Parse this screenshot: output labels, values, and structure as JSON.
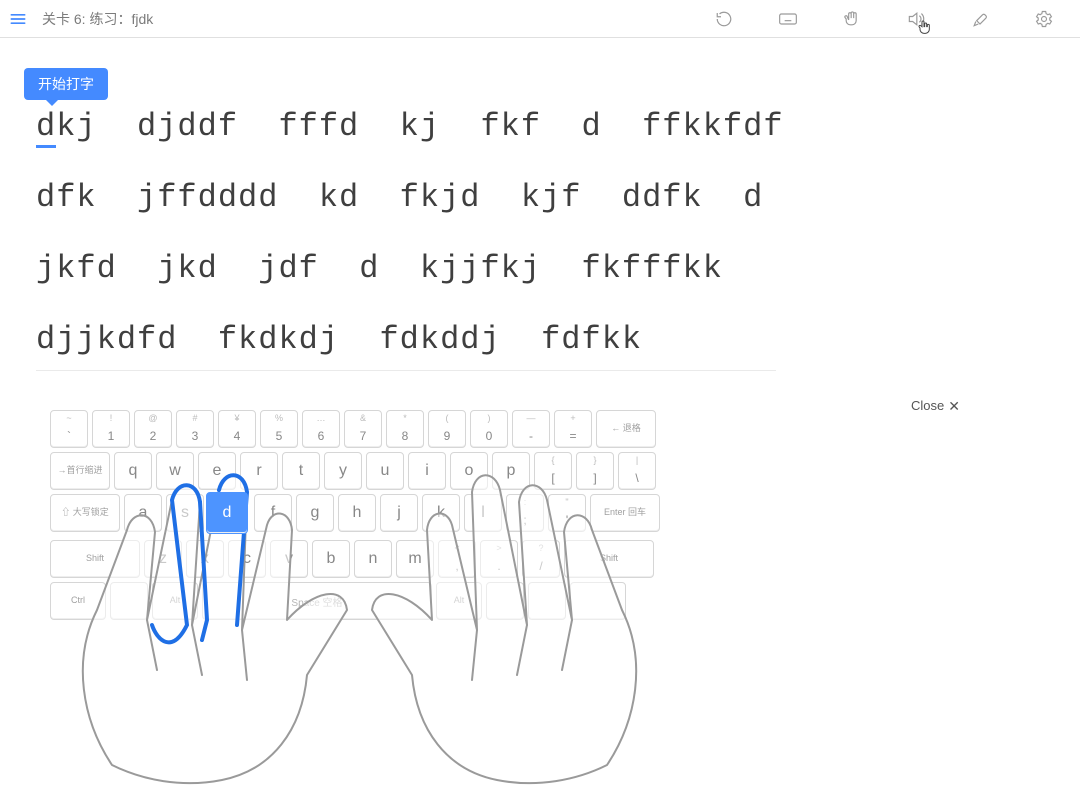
{
  "header": {
    "level_prefix": "关卡 6: 练习：",
    "level_name": "fjdk"
  },
  "tooltip": {
    "start_typing": "开始打字"
  },
  "text_lines": [
    "dkj  djddf  fffd  kj  fkf  d  ffkkfdf",
    "dfk  jffdddd  kd  fkjd  kjf  ddfk  d",
    "jkfd  jkd  jdf  d  kjjfkj  fkfffkk",
    "djjkdfd  fkdkdj  fdkddj  fdfkk"
  ],
  "close": {
    "label": "Close"
  },
  "keys": {
    "backspace": "← 退格",
    "tab": "→首行缩进",
    "caps": "⇧ 大写锁定",
    "enter": "Enter 回车",
    "shift": "Shift",
    "ctrl": "Ctrl",
    "alt": "Alt",
    "space": "Space 空格",
    "row1_tops": [
      "~",
      "!",
      "@",
      "#",
      "¥",
      "%",
      "…",
      "&",
      "*",
      "(",
      ")",
      "—",
      "+"
    ],
    "row1_mains": [
      "`",
      "1",
      "2",
      "3",
      "4",
      "5",
      "6",
      "7",
      "8",
      "9",
      "0",
      "-",
      "="
    ],
    "row2": [
      "q",
      "w",
      "e",
      "r",
      "t",
      "y",
      "u",
      "i",
      "o",
      "p"
    ],
    "row2_bracket_tops": [
      "{",
      "}",
      "|"
    ],
    "row2_bracket_mains": [
      "[",
      "]",
      "\\"
    ],
    "row3": [
      "a",
      "s",
      "d",
      "f",
      "g",
      "h",
      "j",
      "k",
      "l"
    ],
    "row3_tops": [
      ":",
      "\""
    ],
    "row3_mains": [
      ";",
      "'"
    ],
    "row4": [
      "z",
      "x",
      "c",
      "v",
      "b",
      "n",
      "m"
    ],
    "row4_tops": [
      "<",
      ">",
      "?"
    ],
    "row4_mains": [
      ",",
      ".",
      "/"
    ],
    "highlight": "d"
  }
}
